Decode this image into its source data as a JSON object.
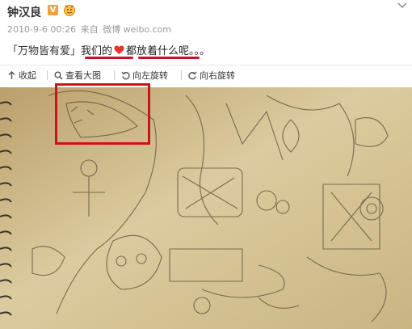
{
  "header": {
    "username": "钟汉良",
    "vip_badge": "V"
  },
  "meta": {
    "timestamp": "2010-9-6 00:26",
    "source_prefix": "来自",
    "source": "微博 weibo.com"
  },
  "post": {
    "tag": "「万物皆有爱」",
    "text_before_heart": "我们的",
    "text_after_heart": "都放着什么呢。。。"
  },
  "toolbar": {
    "collapse": "收起",
    "view_large": "查看大图",
    "rotate_left": "向左旋转",
    "rotate_right": "向右旋转"
  },
  "colors": {
    "accent_red": "#d0111b",
    "paper": "#d8c79a",
    "badge": "#f0a13a"
  }
}
